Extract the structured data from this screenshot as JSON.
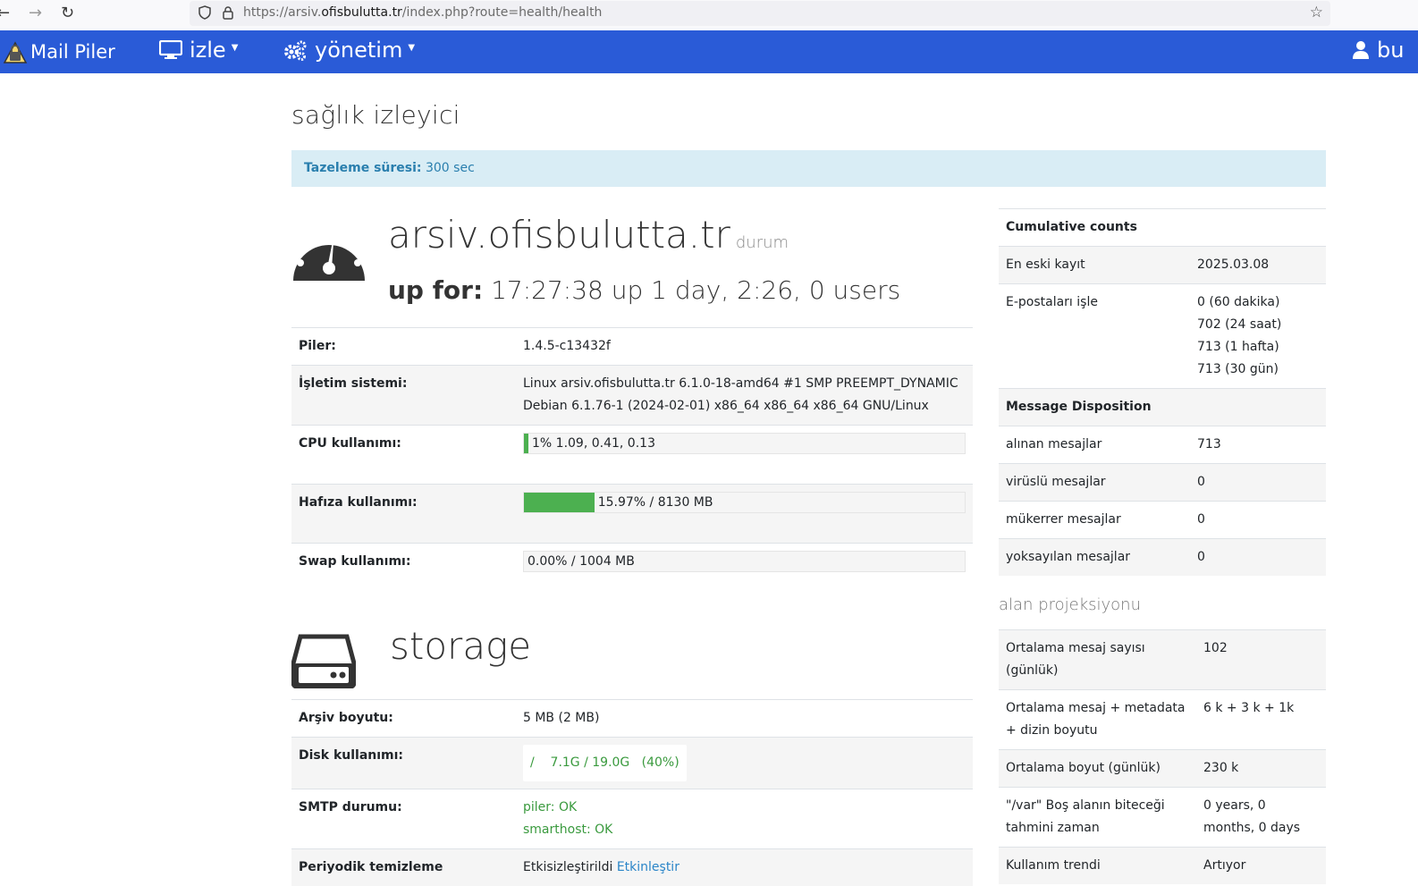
{
  "browser": {
    "url_prefix": "https://arsiv.",
    "url_host": "ofisbulutta.tr",
    "url_path": "/index.php?route=health/health"
  },
  "navbar": {
    "brand": "Mail Piler",
    "monitor_label": "izle",
    "admin_label": "yönetim",
    "user_label": "bu"
  },
  "page": {
    "title": "sağlık izleyici",
    "refresh_label": "Tazeleme süresi:",
    "refresh_value": "300 sec"
  },
  "status": {
    "host": "arsiv.ofisbulutta.tr",
    "host_suffix": "durum",
    "uptime_label": "up for:",
    "uptime_value": "17:27:38 up 1 day, 2:26, 0 users"
  },
  "system_rows": {
    "piler_label": "Piler:",
    "piler_value": "1.4.5-c13432f",
    "os_label": "İşletim sistemi:",
    "os_line1": "Linux arsiv.ofisbulutta.tr 6.1.0-18-amd64 #1 SMP PREEMPT_DYNAMIC",
    "os_line2": "Debian 6.1.76-1 (2024-02-01) x86_64 x86_64 x86_64 GNU/Linux",
    "cpu_label": "CPU kullanımı:",
    "cpu_text": "1% 1.09, 0.41, 0.13",
    "cpu_percent": 1,
    "mem_label": "Hafıza kullanımı:",
    "mem_text": "15.97% / 8130 MB",
    "mem_percent": 15.97,
    "swap_label": "Swap kullanımı:",
    "swap_text": "0.00% / 1004 MB",
    "swap_percent": 0
  },
  "storage": {
    "title": "storage",
    "archive_label": "Arşiv boyutu:",
    "archive_value": "5 MB (2 MB)",
    "disk_label": "Disk kullanımı:",
    "disk_mount": "/",
    "disk_value": "7.1G / 19.0G",
    "disk_percent": "(40%)",
    "smtp_label": "SMTP durumu:",
    "smtp_piler": "piler: OK",
    "smtp_smarthost": "smarthost: OK",
    "purge_label": "Periyodik temizleme",
    "purge_status": "Etkisizleştirildi",
    "purge_link": "Etkinleştir"
  },
  "cumulative": {
    "title": "Cumulative counts",
    "oldest_label": "En eski kayıt",
    "oldest_value": "2025.03.08",
    "processed_label": "E-postaları işle",
    "processed_values": [
      "0 (60 dakika)",
      "702 (24 saat)",
      "713 (1 hafta)",
      "713 (30 gün)"
    ]
  },
  "disposition": {
    "title": "Message Disposition",
    "rows": [
      {
        "label": "alınan mesajlar",
        "value": "713"
      },
      {
        "label": "virüslü mesajlar",
        "value": "0"
      },
      {
        "label": "mükerrer mesajlar",
        "value": "0"
      },
      {
        "label": "yoksayılan mesajlar",
        "value": "0"
      }
    ]
  },
  "projection": {
    "title": "alan projeksiyonu",
    "rows": [
      {
        "label": "Ortalama mesaj sayısı (günlük)",
        "value": "102"
      },
      {
        "label": "Ortalama mesaj + metadata + dizin boyutu",
        "value": "6 k + 3 k + 1k"
      },
      {
        "label": "Ortalama boyut (günlük)",
        "value": "230 k"
      },
      {
        "label": "\"/var\" Boş alanın biteceği tahmini zaman",
        "value": "0 years, 0 months, 0 days"
      },
      {
        "label": "Kullanım trendi",
        "value": "Artıyor"
      }
    ]
  },
  "colors": {
    "navbar": "#2a5bd7",
    "alert_bg": "#d9edf5",
    "bar_fill": "#4cb050",
    "ok_green": "#3a9a3e"
  }
}
